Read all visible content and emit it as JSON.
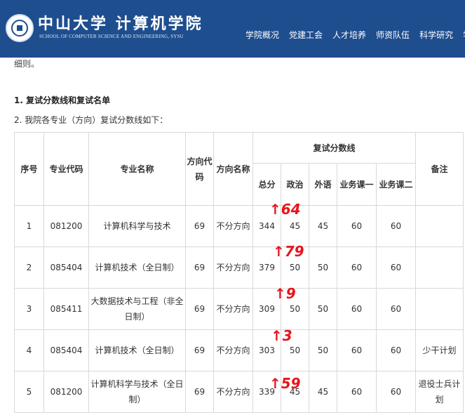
{
  "header": {
    "school_cn": "中山大学 计算机学院",
    "school_en": "SCHOOL OF COMPUTER SCIENCE AND ENGINEERING, SYSU",
    "nav": [
      "学院概况",
      "党建工会",
      "人才培养",
      "师资队伍",
      "科学研究",
      "学"
    ]
  },
  "content": {
    "cut_text": "细则。",
    "heading1": "1. 复试分数线和复试名单",
    "heading2": "2. 我院各专业（方向）复试分数线如下："
  },
  "table": {
    "headers": {
      "seq": "序号",
      "code": "专业代码",
      "major": "专业名称",
      "dir_code": "方向代码",
      "dir_name": "方向名称",
      "score_group": "复试分数线",
      "total": "总分",
      "politics": "政治",
      "foreign": "外语",
      "course1": "业务课一",
      "course2": "业务课二",
      "remark": "备注"
    },
    "rows": [
      {
        "seq": "1",
        "code": "081200",
        "major": "计算机科学与技术",
        "dir_code": "69",
        "dir_name": "不分方向",
        "total": "344",
        "politics": "45",
        "foreign": "45",
        "c1": "60",
        "c2": "60",
        "remark": ""
      },
      {
        "seq": "2",
        "code": "085404",
        "major": "计算机技术（全日制）",
        "dir_code": "69",
        "dir_name": "不分方向",
        "total": "379",
        "politics": "50",
        "foreign": "50",
        "c1": "60",
        "c2": "60",
        "remark": ""
      },
      {
        "seq": "3",
        "code": "085411",
        "major": "大数据技术与工程（非全日制）",
        "dir_code": "69",
        "dir_name": "不分方向",
        "total": "309",
        "politics": "50",
        "foreign": "50",
        "c1": "60",
        "c2": "60",
        "remark": ""
      },
      {
        "seq": "4",
        "code": "085404",
        "major": "计算机技术（全日制）",
        "dir_code": "69",
        "dir_name": "不分方向",
        "total": "303",
        "politics": "50",
        "foreign": "50",
        "c1": "60",
        "c2": "60",
        "remark": "少干计划"
      },
      {
        "seq": "5",
        "code": "081200",
        "major": "计算机科学与技术（全日制）",
        "dir_code": "69",
        "dir_name": "不分方向",
        "total": "339",
        "politics": "45",
        "foreign": "45",
        "c1": "60",
        "c2": "60",
        "remark": "退役士兵计划"
      }
    ]
  },
  "annotations": [
    "↑64",
    "↑79",
    "↑9",
    "↑3",
    "↑59"
  ],
  "colors": {
    "header_bg": "#1f4e8f",
    "annotation": "#e8141c"
  }
}
